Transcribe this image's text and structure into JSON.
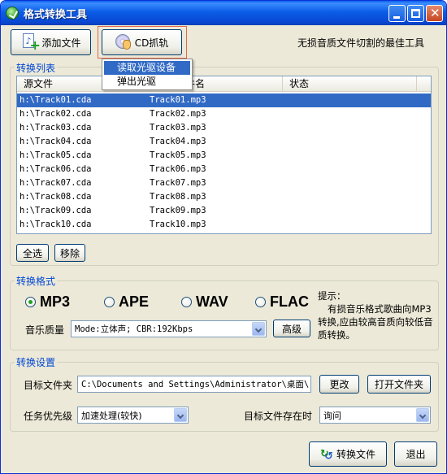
{
  "window": {
    "title": "格式转换工具",
    "controls": {
      "minimize": "minimize",
      "maximize": "maximize",
      "close": "close"
    }
  },
  "toolbar": {
    "add_file_label": "添加文件",
    "cd_rip_label": "CD抓轨",
    "slogan": "无损音质文件切割的最佳工具"
  },
  "cd_menu": {
    "items": [
      {
        "label": "读取光驱设备",
        "selected": true
      },
      {
        "label": "弹出光驱",
        "selected": false
      }
    ]
  },
  "convert_list": {
    "group_label": "转换列表",
    "columns": [
      "源文件",
      "目标文件名",
      "状态"
    ],
    "rows": [
      {
        "source": "h:\\Track01.cda",
        "target": "Track01.mp3",
        "status": ""
      },
      {
        "source": "h:\\Track02.cda",
        "target": "Track02.mp3",
        "status": ""
      },
      {
        "source": "h:\\Track03.cda",
        "target": "Track03.mp3",
        "status": ""
      },
      {
        "source": "h:\\Track04.cda",
        "target": "Track04.mp3",
        "status": ""
      },
      {
        "source": "h:\\Track05.cda",
        "target": "Track05.mp3",
        "status": ""
      },
      {
        "source": "h:\\Track06.cda",
        "target": "Track06.mp3",
        "status": ""
      },
      {
        "source": "h:\\Track07.cda",
        "target": "Track07.mp3",
        "status": ""
      },
      {
        "source": "h:\\Track08.cda",
        "target": "Track08.mp3",
        "status": ""
      },
      {
        "source": "h:\\Track09.cda",
        "target": "Track09.mp3",
        "status": ""
      },
      {
        "source": "h:\\Track10.cda",
        "target": "Track10.mp3",
        "status": ""
      }
    ],
    "selected_row": 1,
    "select_all_label": "全选",
    "remove_label": "移除"
  },
  "format": {
    "group_label": "转换格式",
    "options": [
      {
        "label": "MP3",
        "checked": true
      },
      {
        "label": "APE",
        "checked": false
      },
      {
        "label": "WAV",
        "checked": false
      },
      {
        "label": "FLAC",
        "checked": false
      }
    ],
    "quality_label": "音乐质量",
    "quality_value": "Mode:立体声; CBR:192Kbps",
    "advanced_label": "高级",
    "hint_title": "提示：",
    "hint_body": "有损音乐格式歌曲向MP3转换,应由较高音质向较低音质转换。"
  },
  "settings": {
    "group_label": "转换设置",
    "target_folder_label": "目标文件夹",
    "target_folder_value": "C:\\Documents and Settings\\Administrator\\桌面\\",
    "change_label": "更改",
    "open_folder_label": "打开文件夹",
    "priority_label": "任务优先级",
    "priority_value": "加速处理(较快)",
    "exists_label": "目标文件存在时",
    "exists_value": "询问"
  },
  "actions": {
    "convert_label": "转换文件",
    "exit_label": "退出"
  },
  "colors": {
    "title_bar": "#0a5fe8",
    "selection": "#316ac5",
    "group_label": "#0046d5",
    "highlight_border": "#e0694a"
  }
}
